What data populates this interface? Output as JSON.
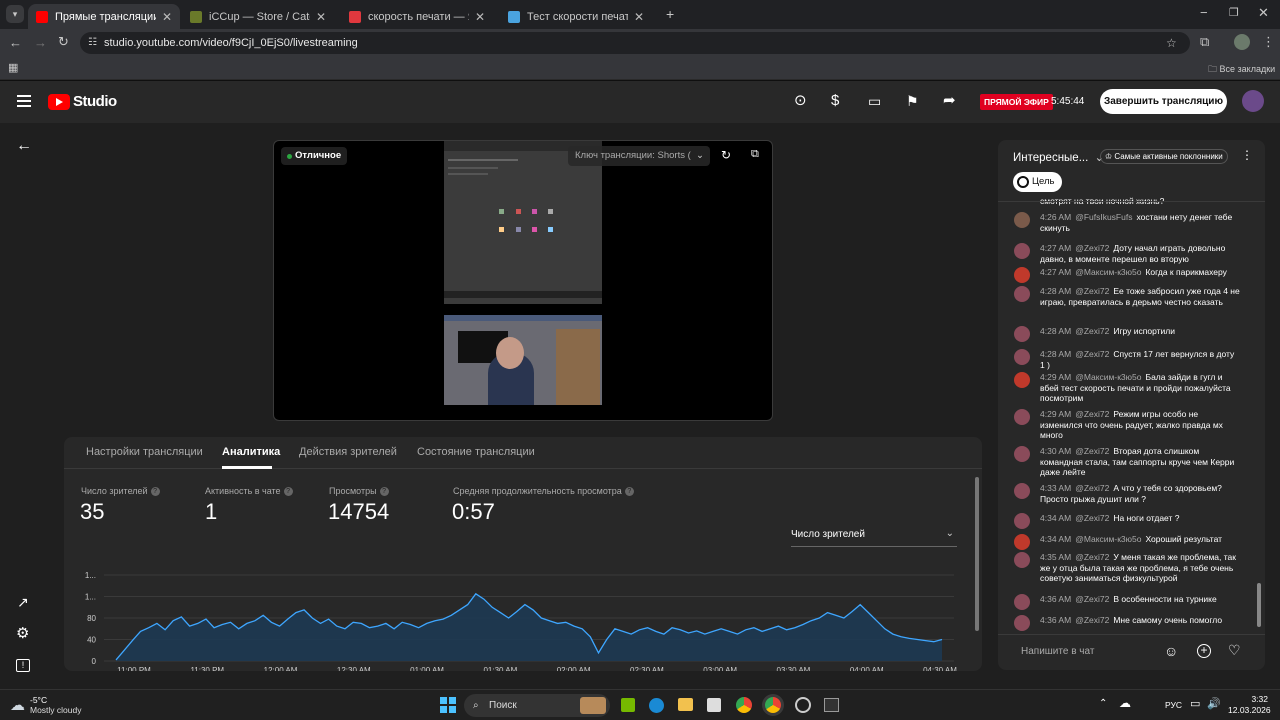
{
  "browser": {
    "tabs": [
      {
        "title": "Прямые трансляции - YouTube",
        "active": true,
        "color": "#ff0000"
      },
      {
        "title": "iCCup — Store / Category: iCCu",
        "active": false,
        "color": "#6a7a2a"
      },
      {
        "title": "скорость печати — Яндекс: на",
        "active": false,
        "color": "#e0383e"
      },
      {
        "title": "Тест скорости печати",
        "active": false,
        "color": "#4aa3df"
      }
    ],
    "url": "studio.youtube.com/video/f9CjI_0EjS0/livestreaming",
    "bookmarks_label": "Все закладки"
  },
  "studio": {
    "logo_text": "Studio",
    "live_badge": "ПРЯМОЙ ЭФИР",
    "live_time": "5:45:44",
    "end_button": "Завершить трансляцию"
  },
  "preview": {
    "status": "Отличное",
    "stream_key_label": "Ключ трансляции: Shorts (",
    "status_color": "#2ba640"
  },
  "tabs": [
    {
      "label": "Настройки трансляции",
      "active": false
    },
    {
      "label": "Аналитика",
      "active": true
    },
    {
      "label": "Действия зрителей",
      "active": false
    },
    {
      "label": "Состояние трансляции",
      "active": false
    }
  ],
  "stats": [
    {
      "label": "Число зрителей",
      "value": "35"
    },
    {
      "label": "Активность в чате",
      "value": "1"
    },
    {
      "label": "Просмотры",
      "value": "14754"
    },
    {
      "label": "Средняя продолжительность просмотра",
      "value": "0:57"
    }
  ],
  "metric_select": "Число зрителей",
  "chart_data": {
    "type": "area",
    "y_tick_labels": [
      "0",
      "40",
      "80",
      "1...",
      "1..."
    ],
    "x_tick_labels": [
      "11:00 PM",
      "11:30 PM",
      "12:00 AM",
      "12:30 AM",
      "01:00 AM",
      "01:30 AM",
      "02:00 AM",
      "02:30 AM",
      "03:00 AM",
      "03:30 AM",
      "04:00 AM",
      "04:30 AM"
    ],
    "ylim": [
      0,
      160
    ],
    "series": [
      {
        "values": [
          2,
          20,
          38,
          55,
          62,
          70,
          58,
          75,
          82,
          65,
          70,
          78,
          62,
          68,
          72,
          60,
          70,
          75,
          85,
          72,
          65,
          78,
          90,
          95,
          80,
          70,
          78,
          65,
          60,
          72,
          70,
          62,
          65,
          70,
          60,
          72,
          68,
          62,
          70,
          75,
          78,
          85,
          95,
          105,
          125,
          115,
          100,
          90,
          80,
          92,
          105,
          95,
          80,
          75,
          70,
          72,
          65,
          60,
          45,
          15,
          40,
          60,
          55,
          50,
          58,
          62,
          55,
          50,
          62,
          58,
          52,
          56,
          50,
          55,
          60,
          55,
          50,
          58,
          62,
          55,
          60,
          65,
          58,
          62,
          68,
          75,
          80,
          90,
          85,
          80,
          92,
          105,
          90,
          75,
          60,
          50,
          45,
          42,
          40,
          38,
          36,
          40
        ]
      }
    ],
    "colors": {
      "line": "#3ea6ff",
      "fill": "#1c3a55"
    }
  },
  "chat": {
    "title": "Интересные...",
    "fans_label": "Самые активные поклонники",
    "goal_label": "Цель",
    "input_placeholder": "Напишите в чат",
    "cut_text": "смотрят на твои ночной жизнь?",
    "messages": [
      {
        "time": "4:26 AM",
        "author": "@FufsIkusFufs",
        "text": "хостани нету денег тебе скинуть",
        "avatar": "#7a5a4a"
      },
      {
        "time": "4:27 AM",
        "author": "@Zexi72",
        "text": "Доту начал играть довольно давно, в моменте перешел во вторую",
        "avatar": "#8a4b5a"
      },
      {
        "time": "4:27 AM",
        "author": "@Максим-к3ю5о",
        "text": "Когда к парикмахеру",
        "avatar": "#c0392b"
      },
      {
        "time": "4:28 AM",
        "author": "@Zexi72",
        "text": "Ее тоже забросил уже года 4 не играю, превратилась в дерьмо честно сказать",
        "avatar": "#8a4b5a"
      },
      {
        "time": "4:28 AM",
        "author": "@Zexi72",
        "text": "Игру испортили",
        "avatar": "#8a4b5a"
      },
      {
        "time": "4:28 AM",
        "author": "@Zexi72",
        "text": "Спустя 17 лет вернулся в доту 1 )",
        "avatar": "#8a4b5a"
      },
      {
        "time": "4:29 AM",
        "author": "@Максим-к3ю5о",
        "text": "Бала зайди в гугл и вбей тест скорость печати и пройди пожалуйста посмотрим",
        "avatar": "#c0392b"
      },
      {
        "time": "4:29 AM",
        "author": "@Zexi72",
        "text": "Режим игры особо не изменился что очень радует, жалко правда мх много",
        "avatar": "#8a4b5a"
      },
      {
        "time": "4:30 AM",
        "author": "@Zexi72",
        "text": "Вторая дота слишком командная стала, там саппорты круче чем Керри даже лейте",
        "avatar": "#8a4b5a"
      },
      {
        "time": "4:33 AM",
        "author": "@Zexi72",
        "text": "А что у тебя со здоровьем? Просто грыжа душит или ?",
        "avatar": "#8a4b5a"
      },
      {
        "time": "4:34 AM",
        "author": "@Zexi72",
        "text": "На ноги отдает ?",
        "avatar": "#8a4b5a"
      },
      {
        "time": "4:34 AM",
        "author": "@Максим-к3ю5о",
        "text": "Хороший результат",
        "avatar": "#c0392b"
      },
      {
        "time": "4:35 AM",
        "author": "@Zexi72",
        "text": "У меня такая же проблема, так же у отца была такая же проблема, я тебе очень советую заниматься физкультурой",
        "avatar": "#8a4b5a"
      },
      {
        "time": "4:36 AM",
        "author": "@Zexi72",
        "text": "В особенности на турнике",
        "avatar": "#8a4b5a"
      },
      {
        "time": "4:36 AM",
        "author": "@Zexi72",
        "text": "Мне самому очень помогло",
        "avatar": "#8a4b5a"
      }
    ]
  },
  "taskbar": {
    "weather_temp": "-5°C",
    "weather_desc": "Mostly cloudy",
    "search_label": "Поиск",
    "lang": "РУС",
    "time": "3:32",
    "date": "12.03.2026"
  }
}
